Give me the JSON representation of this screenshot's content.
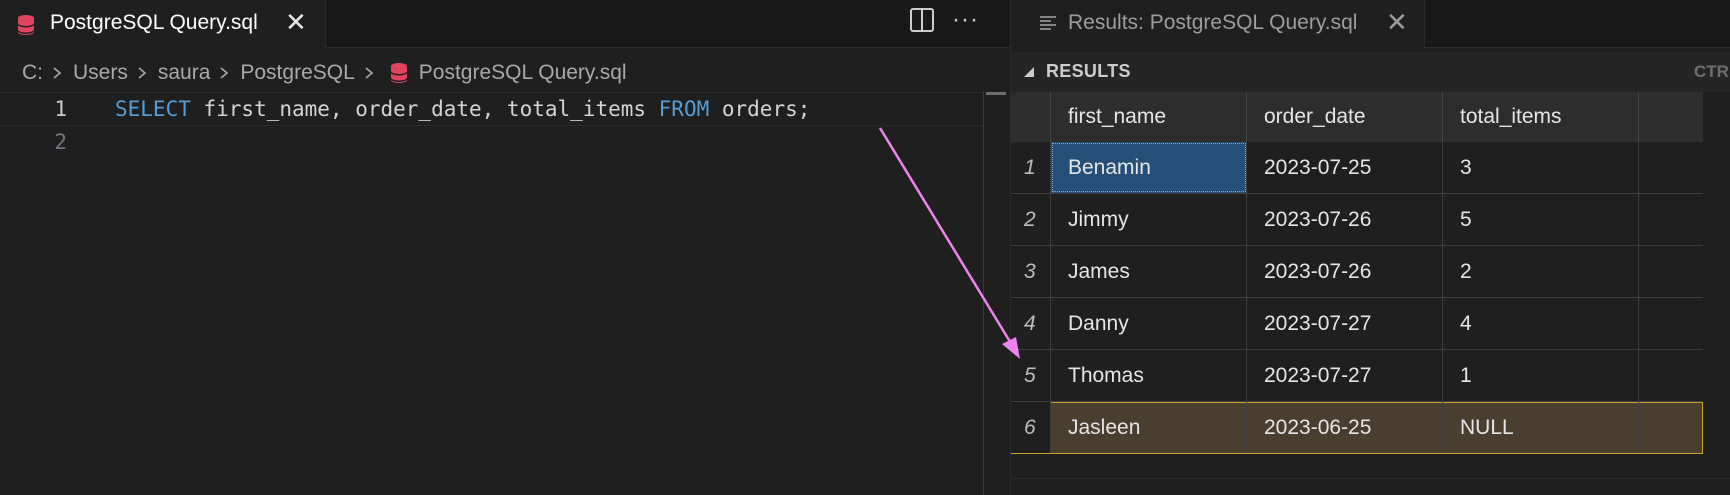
{
  "editor": {
    "tab": {
      "title": "PostgreSQL Query.sql",
      "close": "✕"
    },
    "breadcrumb": [
      "C:",
      "Users",
      "saura",
      "PostgreSQL",
      "PostgreSQL Query.sql"
    ],
    "lines": [
      {
        "number": "1",
        "tokens": [
          {
            "text": "SELECT",
            "kind": "keyword"
          },
          {
            "text": " first_name, order_date, total_items ",
            "kind": "plain"
          },
          {
            "text": "FROM",
            "kind": "keyword"
          },
          {
            "text": " orders;",
            "kind": "plain"
          }
        ]
      },
      {
        "number": "2",
        "tokens": []
      }
    ],
    "more_actions": "···"
  },
  "results": {
    "tab": {
      "title": "Results: PostgreSQL Query.sql",
      "close": "✕"
    },
    "section_title": "RESULTS",
    "toolbar_hint": "CTR",
    "columns": [
      "first_name",
      "order_date",
      "total_items"
    ],
    "rows": [
      {
        "n": "1",
        "cells": [
          "Benamin",
          "2023-07-25",
          "3"
        ]
      },
      {
        "n": "2",
        "cells": [
          "Jimmy",
          "2023-07-26",
          "5"
        ]
      },
      {
        "n": "3",
        "cells": [
          "James",
          "2023-07-26",
          "2"
        ]
      },
      {
        "n": "4",
        "cells": [
          "Danny",
          "2023-07-27",
          "4"
        ]
      },
      {
        "n": "5",
        "cells": [
          "Thomas",
          "2023-07-27",
          "1"
        ]
      },
      {
        "n": "6",
        "cells": [
          "Jasleen",
          "2023-06-25",
          "NULL"
        ]
      }
    ]
  },
  "colors": {
    "keyword": "#569cd6",
    "db_icon": "#e0445e",
    "selection": "#264f78",
    "row_highlight": "#4a3f2e",
    "row_highlight_border": "#c9a227",
    "annotation_arrow": "#ee82ee"
  }
}
